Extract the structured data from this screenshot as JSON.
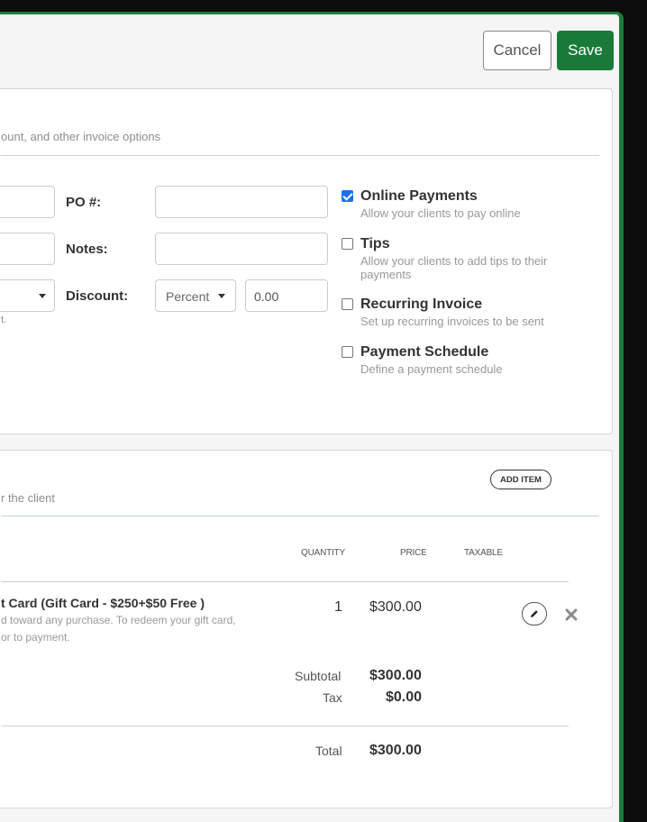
{
  "header": {
    "cancel_label": "Cancel",
    "save_label": "Save"
  },
  "options_section": {
    "subtitle": "ount, and other invoice options",
    "po_label": "PO #:",
    "notes_label": "Notes:",
    "discount_label": "Discount:",
    "discount_type": "Percent",
    "discount_value": "0.00",
    "left_partial_text": "t.",
    "options": [
      {
        "title": "Online Payments",
        "desc": "Allow your clients to pay online",
        "checked": true
      },
      {
        "title": "Tips",
        "desc": "Allow your clients to add tips to their payments",
        "checked": false
      },
      {
        "title": "Recurring Invoice",
        "desc": "Set up recurring invoices to be sent",
        "checked": false
      },
      {
        "title": "Payment Schedule",
        "desc": "Define a payment schedule",
        "checked": false
      }
    ]
  },
  "items_section": {
    "subtitle": "r the client",
    "add_item_label": "ADD ITEM",
    "columns": {
      "quantity": "QUANTITY",
      "price": "PRICE",
      "taxable": "TAXABLE"
    },
    "item": {
      "name": "t Card (Gift Card - $250+$50 Free )",
      "desc_line1": "d toward any purchase.  To redeem your gift card,",
      "desc_line2": "or to payment.",
      "quantity": "1",
      "price": "$300.00"
    },
    "totals": {
      "subtotal_label": "Subtotal",
      "subtotal_value": "$300.00",
      "tax_label": "Tax",
      "tax_value": "$0.00",
      "total_label": "Total",
      "total_value": "$300.00"
    }
  },
  "icons": {
    "edit": "pencil-icon",
    "remove": "close-icon",
    "check": "checkmark-icon"
  },
  "colors": {
    "brand_green": "#1a7a3a",
    "checkbox_blue": "#1a73e8"
  }
}
